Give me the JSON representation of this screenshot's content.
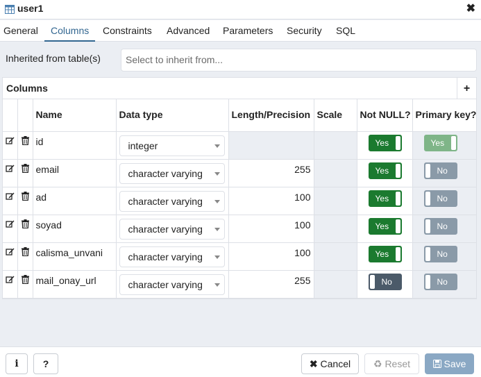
{
  "window": {
    "title": "user1",
    "close_symbol": "✖"
  },
  "tabs": [
    {
      "label": "General"
    },
    {
      "label": "Columns"
    },
    {
      "label": "Constraints"
    },
    {
      "label": "Advanced"
    },
    {
      "label": "Parameters"
    },
    {
      "label": "Security"
    },
    {
      "label": "SQL"
    }
  ],
  "inherit": {
    "label": "Inherited from table(s)",
    "placeholder": "Select to inherit from..."
  },
  "columns": {
    "title": "Columns",
    "add_symbol": "+",
    "headers": [
      "Name",
      "Data type",
      "Length/Precision",
      "Scale",
      "Not NULL?",
      "Primary key?"
    ],
    "rows": [
      {
        "name": "id",
        "data_type": "integer",
        "length": "",
        "scale": "",
        "not_null": "Yes",
        "primary_key": "Yes"
      },
      {
        "name": "email",
        "data_type": "character varying",
        "length": "255",
        "scale": "",
        "not_null": "Yes",
        "primary_key": "No"
      },
      {
        "name": "ad",
        "data_type": "character varying",
        "length": "100",
        "scale": "",
        "not_null": "Yes",
        "primary_key": "No"
      },
      {
        "name": "soyad",
        "data_type": "character varying",
        "length": "100",
        "scale": "",
        "not_null": "Yes",
        "primary_key": "No"
      },
      {
        "name": "calisma_unvani",
        "data_type": "character varying",
        "length": "100",
        "scale": "",
        "not_null": "Yes",
        "primary_key": "No"
      },
      {
        "name": "mail_onay_url",
        "data_type": "character varying",
        "length": "255",
        "scale": "",
        "not_null": "No",
        "primary_key": "No"
      }
    ]
  },
  "footer": {
    "info_symbol": "i",
    "help_symbol": "?",
    "cancel_label": "Cancel",
    "reset_label": "Reset",
    "save_label": "Save"
  },
  "colors": {
    "accent": "#326690",
    "toggle_on": "#1b7a2f",
    "toggle_off": "#4b5a69",
    "save_disabled": "#8aa8c4"
  }
}
